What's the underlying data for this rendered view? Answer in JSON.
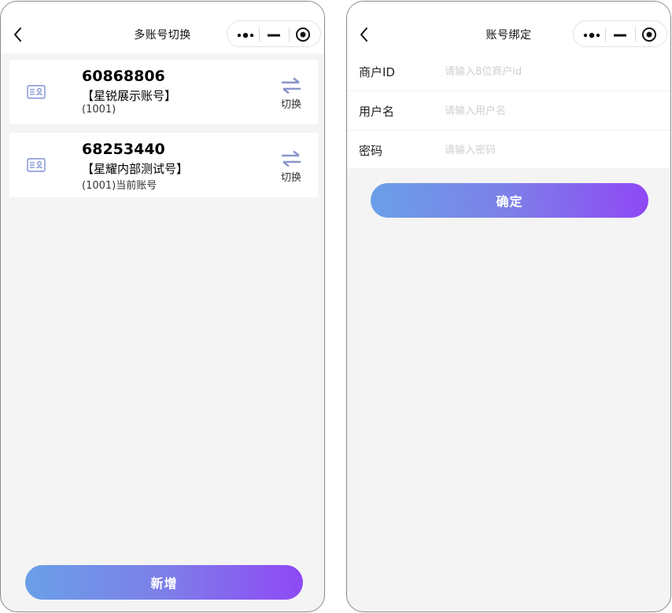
{
  "left_screen": {
    "title": "多账号切换",
    "accounts": [
      {
        "number": "60868806",
        "name": "【星锐展示账号】",
        "sub": "(1001)"
      },
      {
        "number": "68253440",
        "name": "【星耀内部测试号】",
        "sub": "(1001)当前账号"
      }
    ],
    "switch_label": "切换",
    "add_button": "新增"
  },
  "right_screen": {
    "title": "账号绑定",
    "fields": [
      {
        "label": "商户ID",
        "placeholder": "请输入8位商户id"
      },
      {
        "label": "用户名",
        "placeholder": "请输入用户名"
      },
      {
        "label": "密码",
        "placeholder": "请输入密码"
      }
    ],
    "confirm_button": "确定"
  },
  "colors": {
    "gradient_start": "#6a9fe8",
    "gradient_end": "#8f48f5",
    "icon_accent": "#7d8fd6",
    "page_bg": "#f4f4f4"
  },
  "icons": {
    "back": "chevron-left-icon",
    "more": "more-dots-icon",
    "minimize": "minus-icon",
    "close": "target-circle-icon",
    "account": "id-card-icon",
    "switch": "swap-arrows-icon"
  }
}
